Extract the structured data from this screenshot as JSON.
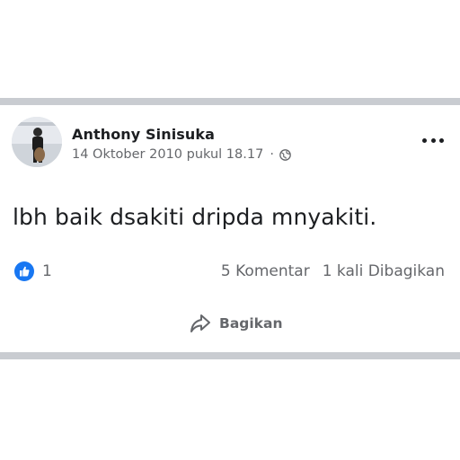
{
  "post": {
    "author": "Anthony Sinisuka",
    "timestamp": "14 Oktober 2010 pukul 18.17",
    "separator": "·",
    "privacy_icon": "globe-icon",
    "menu_icon": "more-options-icon",
    "text": "lbh baik dsakiti dripda mnyakiti.",
    "reactions": {
      "icon": "like-icon",
      "count": "1"
    },
    "comments": "5 Komentar",
    "shares": "1 kali Dibagikan"
  },
  "actions": {
    "share_label": "Bagikan",
    "share_icon": "share-arrow-icon"
  },
  "colors": {
    "text_primary": "#1c1e21",
    "text_secondary": "#65676b",
    "like_blue": "#1877f2",
    "divider": "#c9ccd1"
  }
}
